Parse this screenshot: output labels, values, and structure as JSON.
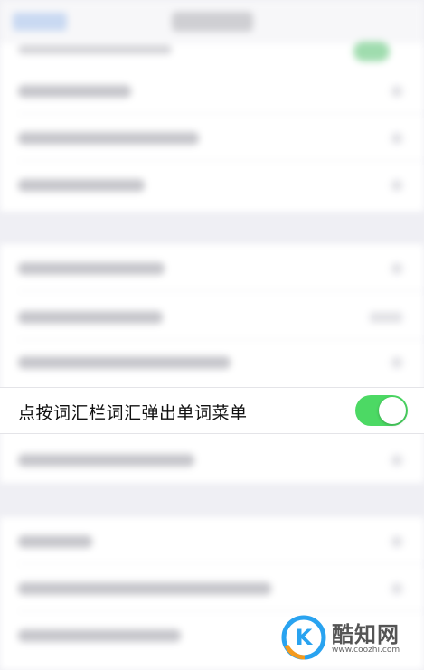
{
  "settings": {
    "highlighted_row": {
      "label": "点按词汇栏词汇弹出单词菜单",
      "toggle_on": true
    }
  },
  "colors": {
    "toggle_on": "#4cd964",
    "background": "#efeff4",
    "watermark_accent": "#29a3f0",
    "watermark_orange": "#f39a1e"
  },
  "watermark": {
    "name": "酷知网",
    "url": "www.coozhi.com"
  }
}
